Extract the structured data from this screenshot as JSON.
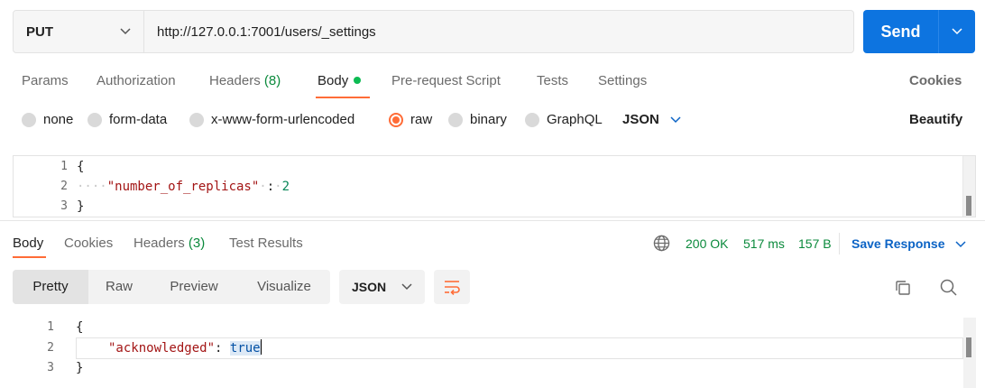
{
  "request": {
    "method": "PUT",
    "url": "http://127.0.0.1:7001/users/_settings",
    "send_label": "Send"
  },
  "req_tabs": {
    "params": "Params",
    "authorization": "Authorization",
    "headers": "Headers",
    "headers_count": "(8)",
    "body": "Body",
    "prerequest": "Pre-request Script",
    "tests": "Tests",
    "settings": "Settings",
    "cookies": "Cookies"
  },
  "body_types": {
    "none": "none",
    "form_data": "form-data",
    "urlencoded": "x-www-form-urlencoded",
    "raw": "raw",
    "binary": "binary",
    "graphql": "GraphQL",
    "format": "JSON",
    "beautify": "Beautify",
    "selected": "raw"
  },
  "request_body": {
    "line_numbers": [
      "1",
      "2",
      "3"
    ],
    "open": "{",
    "key": "\"number_of_replicas\"",
    "colon": ":",
    "value": "2",
    "close": "}"
  },
  "res_tabs": {
    "body": "Body",
    "cookies": "Cookies",
    "headers": "Headers",
    "headers_count": "(3)",
    "test_results": "Test Results"
  },
  "response_status": {
    "status": "200 OK",
    "time": "517 ms",
    "size": "157 B",
    "save_label": "Save Response"
  },
  "response_toolbar": {
    "pretty": "Pretty",
    "raw": "Raw",
    "preview": "Preview",
    "visualize": "Visualize",
    "format": "JSON"
  },
  "response_body": {
    "line_numbers": [
      "1",
      "2",
      "3"
    ],
    "open": "{",
    "key": "\"acknowledged\"",
    "colon": ":",
    "value": "true",
    "close": "}"
  },
  "colors": {
    "accent": "#ff6c37",
    "send": "#0d74e0",
    "success": "#0b8a3c",
    "link": "#0b63c5"
  }
}
